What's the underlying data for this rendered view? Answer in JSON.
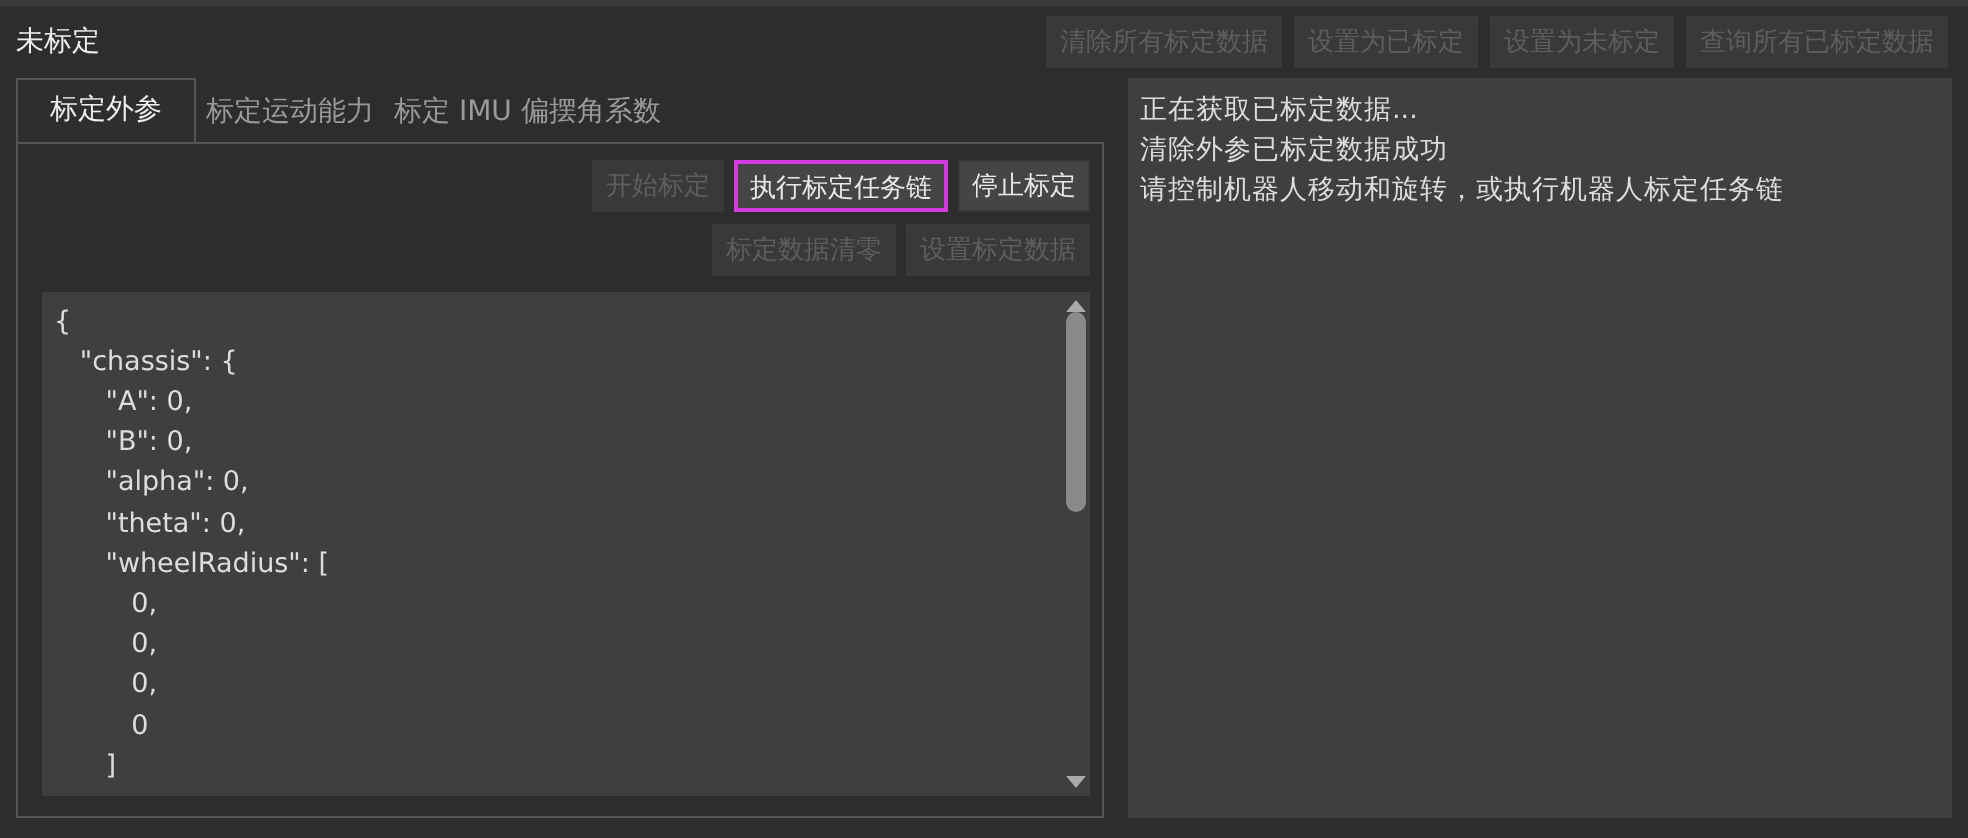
{
  "status": "未标定",
  "top_buttons": [
    {
      "label": "清除所有标定数据",
      "disabled": true
    },
    {
      "label": "设置为已标定",
      "disabled": true
    },
    {
      "label": "设置为未标定",
      "disabled": true
    },
    {
      "label": "查询所有已标定数据",
      "disabled": true
    }
  ],
  "tabs": [
    {
      "label": "标定外参",
      "selected": true
    },
    {
      "label": "标定运动能力",
      "selected": false
    },
    {
      "label": "标定 IMU 偏摆角系数",
      "selected": false
    }
  ],
  "action_rows": [
    [
      {
        "label": "开始标定",
        "disabled": true,
        "focused": false
      },
      {
        "label": "执行标定任务链",
        "disabled": false,
        "focused": true
      },
      {
        "label": "停止标定",
        "disabled": false,
        "focused": false
      }
    ],
    [
      {
        "label": "标定数据清零",
        "disabled": true,
        "focused": false
      },
      {
        "label": "设置标定数据",
        "disabled": true,
        "focused": false
      }
    ]
  ],
  "editor_lines": [
    "{",
    "   \"chassis\": {",
    "      \"A\": 0,",
    "      \"B\": 0,",
    "      \"alpha\": 0,",
    "      \"theta\": 0,",
    "      \"wheelRadius\": [",
    "         0,",
    "         0,",
    "         0,",
    "         0",
    "      ]"
  ],
  "log": [
    "正在获取已标定数据...",
    "清除外参已标定数据成功",
    "请控制机器人移动和旋转，或执行机器人标定任务链"
  ]
}
